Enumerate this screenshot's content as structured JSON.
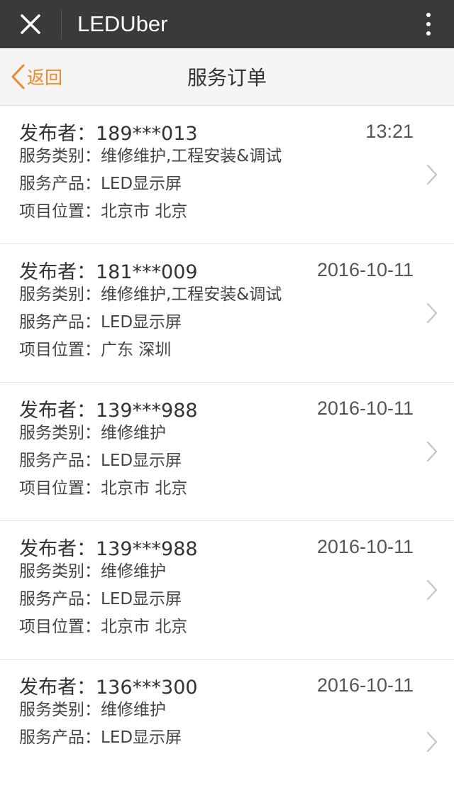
{
  "topbar": {
    "title": "LEDUber",
    "close_icon": "close-icon",
    "more_icon": "more-vertical-icon"
  },
  "navbar": {
    "back_label": "返回",
    "title": "服务订单"
  },
  "colors": {
    "topbar_bg": "#3a3a3c",
    "accent": "#f08a24"
  },
  "orders": [
    {
      "publisher": "发布者：189***013",
      "time": "13:21",
      "category": "服务类别：维修维护,工程安装&调试",
      "product": "服务产品：LED显示屏",
      "location": "项目位置：北京市 北京"
    },
    {
      "publisher": "发布者：181***009",
      "time": "2016-10-11",
      "category": "服务类别：维修维护,工程安装&调试",
      "product": "服务产品：LED显示屏",
      "location": "项目位置：广东 深圳"
    },
    {
      "publisher": "发布者：139***988",
      "time": "2016-10-11",
      "category": "服务类别：维修维护",
      "product": "服务产品：LED显示屏",
      "location": "项目位置：北京市 北京"
    },
    {
      "publisher": "发布者：139***988",
      "time": "2016-10-11",
      "category": "服务类别：维修维护",
      "product": "服务产品：LED显示屏",
      "location": "项目位置：北京市 北京"
    },
    {
      "publisher": "发布者：136***300",
      "time": "2016-10-11",
      "category": "服务类别：维修维护",
      "product": "服务产品：LED显示屏"
    }
  ]
}
